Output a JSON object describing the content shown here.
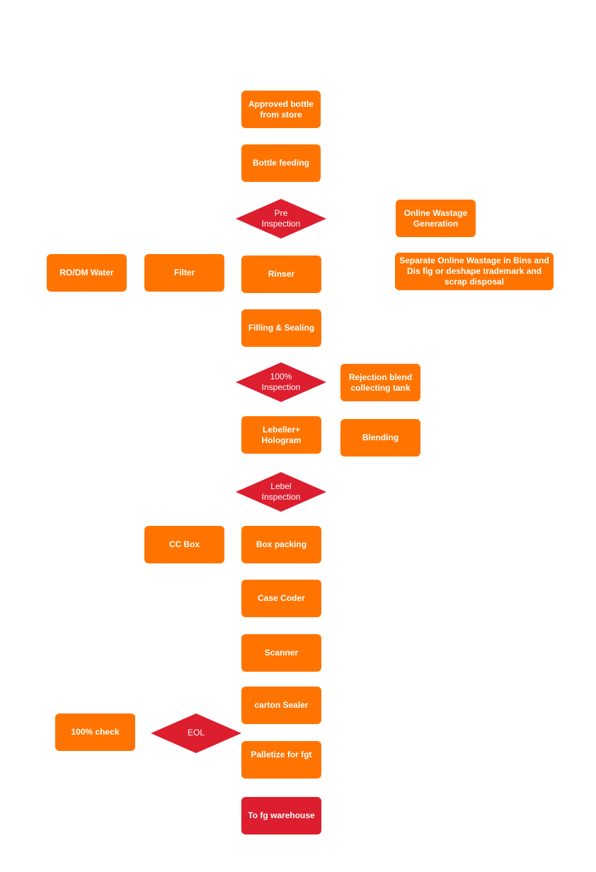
{
  "colors": {
    "process": "#ff7400",
    "decision": "#dc1e2e",
    "terminal": "#dc1e2e"
  },
  "boxes": {
    "approved_bottle": "Approved bottle from store",
    "bottle_feeding": "Bottle feeding",
    "online_wastage": "Online Wastage Generation",
    "separate_wastage": "Separate Online Wastage in Bins and Dis fig or deshape trademark and scrap disposal",
    "ro_dm_water": "RO/DM Water",
    "filter": "Filter",
    "rinser": "Rinser",
    "filling_sealing": "Filling & Sealing",
    "rejection_blend": "Rejection blend collecting tank",
    "labeller_hologram": "Lebeller+ Hologram",
    "blending": "Blending",
    "cc_box": "CC Box",
    "box_packing": "Box packing",
    "case_coder": "Case Coder",
    "scanner": "Scanner",
    "carton_sealer": "carton Sealer",
    "check_100": "100% check",
    "palletize": "Palletize for fgt",
    "to_fg_warehouse": "To fg warehouse"
  },
  "decisions": {
    "pre_inspection": "Pre\nInspection",
    "inspection_100": "100%\nInspection",
    "label_inspection": "Lebel\nInspection",
    "eol": "EOL"
  }
}
